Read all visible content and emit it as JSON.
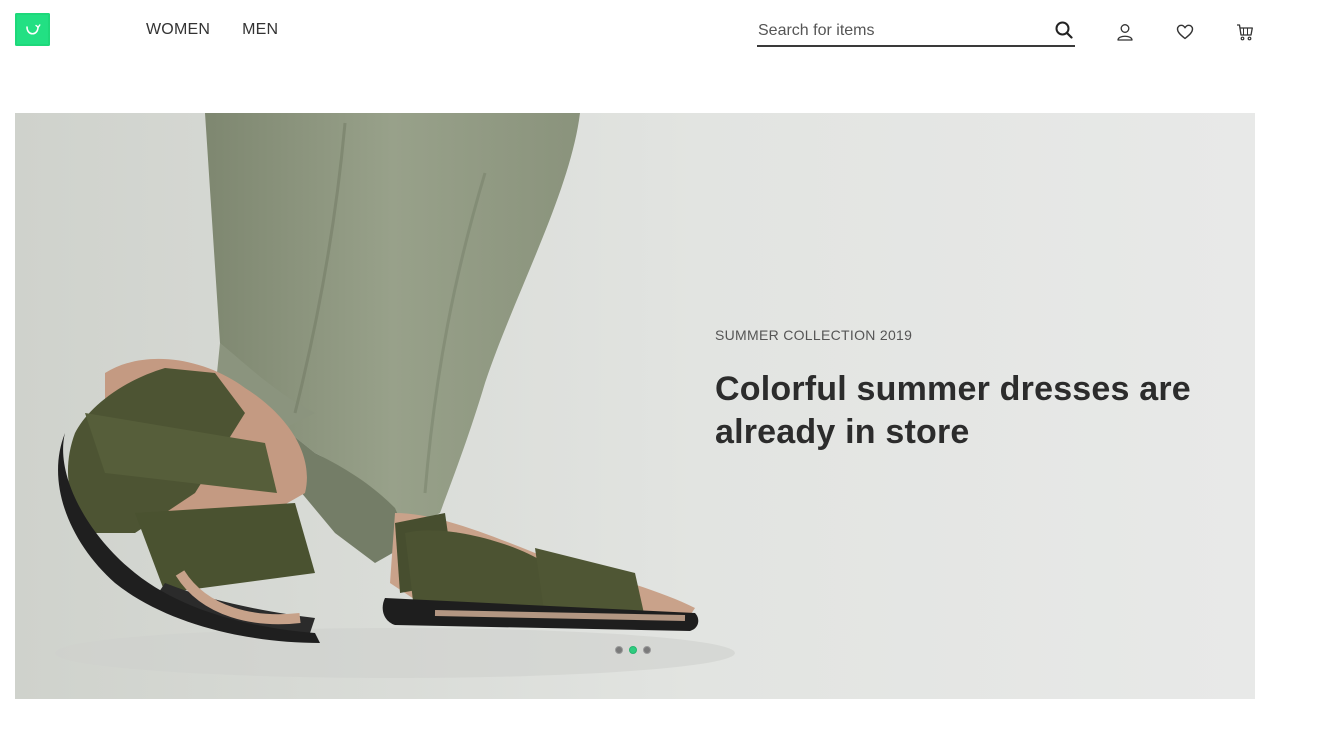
{
  "brand": {
    "logo_icon": "shopping-bag-icon",
    "accent_color": "#1ed87a"
  },
  "nav": {
    "items": [
      {
        "label": "WOMEN"
      },
      {
        "label": "MEN"
      }
    ]
  },
  "search": {
    "value": "",
    "placeholder": "Search for items",
    "icon": "search-icon"
  },
  "header_actions": [
    {
      "icon": "user-icon"
    },
    {
      "icon": "heart-icon"
    },
    {
      "icon": "cart-icon"
    }
  ],
  "hero": {
    "eyebrow": "SUMMER COLLECTION 2019",
    "title": "Colorful summer dresses are already in store",
    "carousel": {
      "slide_count": 3,
      "active_index": 1,
      "active_color": "#2ecc7f"
    }
  }
}
